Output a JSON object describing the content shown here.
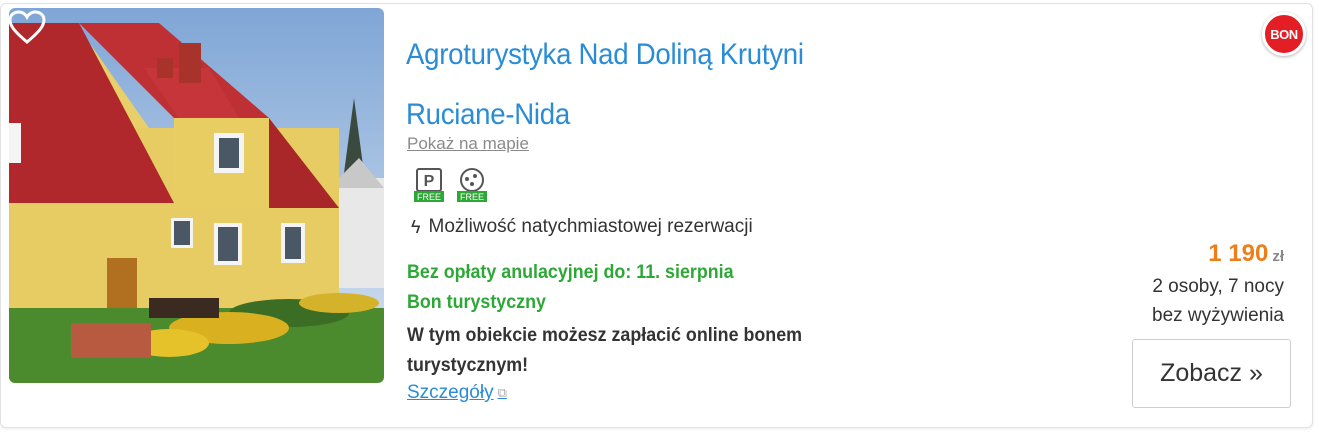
{
  "listing": {
    "title": "Agroturystyka Nad Doliną Krutyni",
    "location": "Ruciane-Nida",
    "map_link": "Pokaż na mapie",
    "badge": "BON",
    "amenities": [
      {
        "icon": "parking-icon",
        "tag": "FREE"
      },
      {
        "icon": "wifi-icon",
        "tag": "FREE"
      }
    ],
    "instant_booking": "Możliwość natychmiastowej rezerwacji",
    "free_cancel": "Bez opłaty anulacyjnej do: 11. sierpnia",
    "voucher_title": "Bon turystyczny",
    "voucher_desc": "W tym obiekcie możesz zapłacić online bonem turystycznym!",
    "details_link": "Szczegóły",
    "price": "1 190",
    "currency": "zł",
    "persons_nights": "2 osoby, 7 nocy",
    "board": "bez wyżywienia",
    "cta": "Zobacz »"
  },
  "colors": {
    "title": "#2a8cd6",
    "green": "#2da836",
    "price": "#ef7d1a",
    "badge": "#e31e24"
  }
}
